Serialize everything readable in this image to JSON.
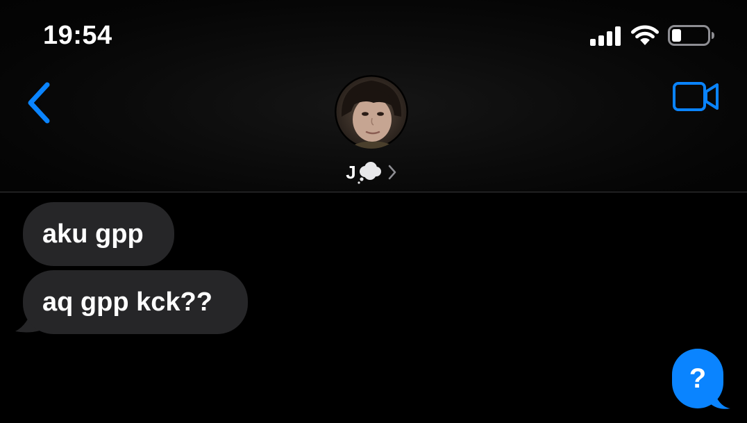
{
  "status_bar": {
    "time": "19:54",
    "signal_icon": "cellular-signal-icon",
    "wifi_icon": "wifi-icon",
    "battery_icon": "battery-icon",
    "battery_level": 0.25
  },
  "nav": {
    "back_icon": "chevron-left-icon",
    "video_icon": "video-camera-icon",
    "contact": {
      "name": "J",
      "name_emoji_icon": "thought-balloon-icon",
      "chevron_icon": "chevron-right-icon",
      "avatar": "contact-avatar-photo"
    }
  },
  "messages": [
    {
      "text": "aku gpp",
      "direction": "incoming"
    },
    {
      "text": "aq gpp kck??",
      "direction": "incoming"
    }
  ],
  "help_button": {
    "label": "?",
    "icon": "question-bubble-icon"
  },
  "colors": {
    "background": "#000000",
    "accent": "#0A84FF",
    "bubble_incoming": "#262628",
    "divider": "#3A3A3C",
    "text": "#FFFFFF"
  }
}
